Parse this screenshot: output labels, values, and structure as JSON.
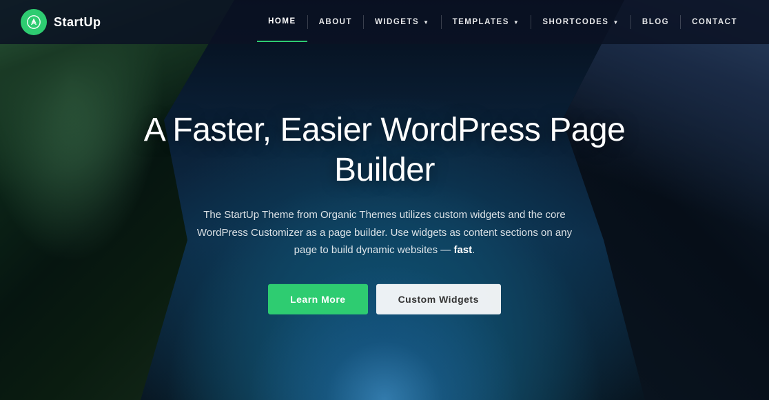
{
  "logo": {
    "text": "StartUp",
    "icon_label": "startup-logo-icon"
  },
  "nav": {
    "items": [
      {
        "label": "HOME",
        "active": true,
        "has_dropdown": false
      },
      {
        "label": "ABOUT",
        "active": false,
        "has_dropdown": false
      },
      {
        "label": "WIDGETS",
        "active": false,
        "has_dropdown": true
      },
      {
        "label": "TEMPLATES",
        "active": false,
        "has_dropdown": true
      },
      {
        "label": "SHORTCODES",
        "active": false,
        "has_dropdown": true
      },
      {
        "label": "BLOG",
        "active": false,
        "has_dropdown": false
      },
      {
        "label": "CONTACT",
        "active": false,
        "has_dropdown": false
      }
    ]
  },
  "hero": {
    "title": "A Faster, Easier WordPress Page Builder",
    "subtitle_part1": "The StartUp Theme from Organic Themes utilizes custom widgets and the core WordPress Customizer as a page builder. Use widgets as content sections on any page to build dynamic websites —",
    "subtitle_bold": "fast",
    "subtitle_end": ".",
    "btn_primary": "Learn More",
    "btn_secondary": "Custom Widgets"
  },
  "colors": {
    "accent": "#2ecc71",
    "nav_bg": "rgba(10,18,35,0.85)",
    "btn_primary_bg": "#2ecc71",
    "btn_secondary_bg": "rgba(255,255,255,0.92)"
  }
}
